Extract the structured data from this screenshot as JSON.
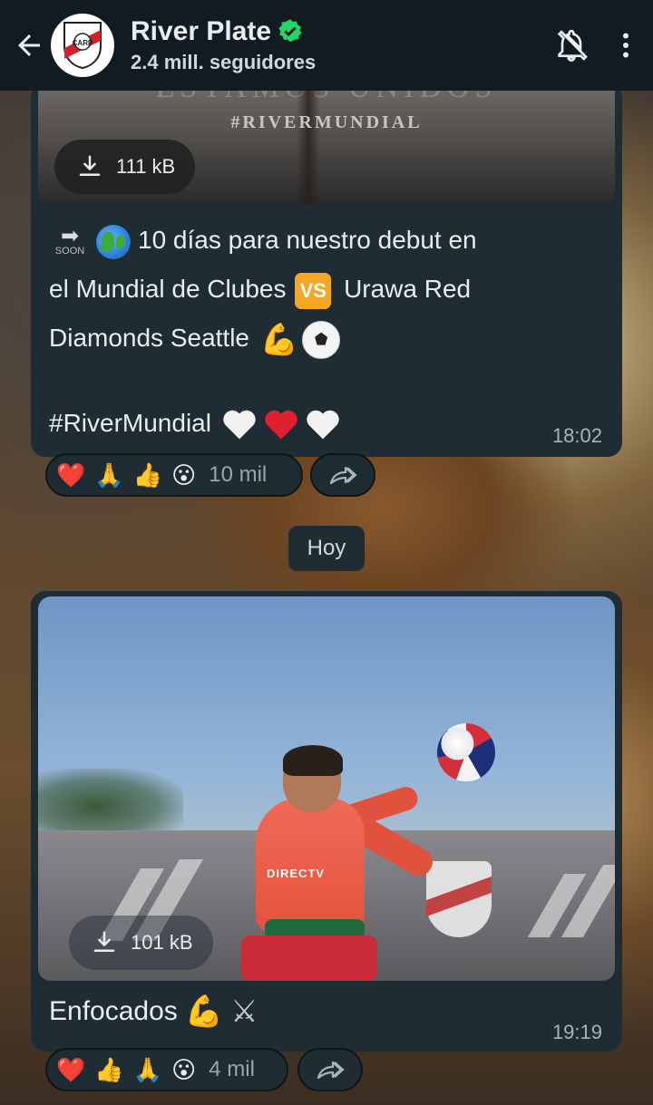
{
  "header": {
    "channel_name": "River Plate",
    "followers": "2.4 mill. seguidores"
  },
  "messages": [
    {
      "media": {
        "heading": "ESTAMOS UNIDOS",
        "hashtag": "#RIVERMUNDIAL",
        "download_size": "111 kB"
      },
      "soon_label": "SOON",
      "line1": "10 días para nuestro debut en",
      "line2a": "el Mundial de Clubes",
      "vs_label": "VS",
      "line2b": "Urawa Red",
      "line3": "Diamonds Seattle",
      "hashtag_line": "#RiverMundial",
      "time": "18:02",
      "reactions": {
        "emojis": [
          "❤️",
          "🙏",
          "👍",
          "😮"
        ],
        "count": "10 mil"
      }
    },
    {
      "media": {
        "download_size": "101 kB",
        "jersey_text": "DIRECTV"
      },
      "caption": "Enfocados",
      "time": "19:19",
      "reactions": {
        "emojis": [
          "❤️",
          "👍",
          "🙏",
          "😮"
        ],
        "count": "4 mil"
      }
    }
  ],
  "date_separator": "Hoy",
  "icons": {
    "back": "arrow-left-icon",
    "verified": "verified-check-icon",
    "mute": "bell-off-icon",
    "more": "more-vertical-icon",
    "download": "download-icon",
    "forward": "forward-icon"
  },
  "colors": {
    "header_bg": "#111b21",
    "bubble_bg": "#1f2c34",
    "verified": "#25d366",
    "time": "#a8b3ba"
  }
}
